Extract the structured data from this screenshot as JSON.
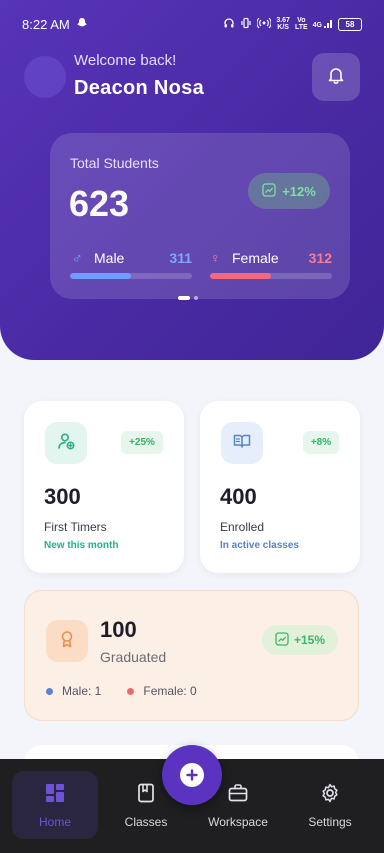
{
  "status_bar": {
    "time": "8:22 AM",
    "speed_value": "3.67",
    "speed_unit": "K/S",
    "network_top": "Vo",
    "network_bottom": "LTE",
    "signal_label": "4G",
    "battery": "58"
  },
  "header": {
    "welcome": "Welcome back!",
    "user_name": "Deacon Nosa"
  },
  "total_students": {
    "label": "Total Students",
    "value": "623",
    "growth": "+12%",
    "male_label": "Male",
    "male_value": "311",
    "male_fraction": 0.499,
    "female_label": "Female",
    "female_value": "312",
    "female_fraction": 0.501,
    "carousel_pages": 2,
    "carousel_active": 0
  },
  "stats": {
    "first_timers": {
      "value": "300",
      "label": "First Timers",
      "sub": "New this month",
      "change": "+25%"
    },
    "enrolled": {
      "value": "400",
      "label": "Enrolled",
      "sub": "In active classes",
      "change": "+8%"
    },
    "graduated": {
      "value": "100",
      "label": "Graduated",
      "change": "+15%",
      "male": "Male: 1",
      "female": "Female: 0"
    }
  },
  "nav": {
    "home": "Home",
    "classes": "Classes",
    "workspace": "Workspace",
    "settings": "Settings",
    "active": "Home"
  },
  "colors": {
    "brand": "#5734b8",
    "male": "#6f9cff",
    "female": "#f46a7c",
    "positive": "#2fb565"
  },
  "icons": {
    "bell": "bell-icon",
    "trend": "trending-up-icon",
    "user_add": "user-plus-icon",
    "book": "open-book-icon",
    "award": "award-icon",
    "home": "grid-icon",
    "classes": "notebook-icon",
    "workspace": "briefcase-icon",
    "settings": "gear-icon",
    "fab": "plus-icon"
  }
}
